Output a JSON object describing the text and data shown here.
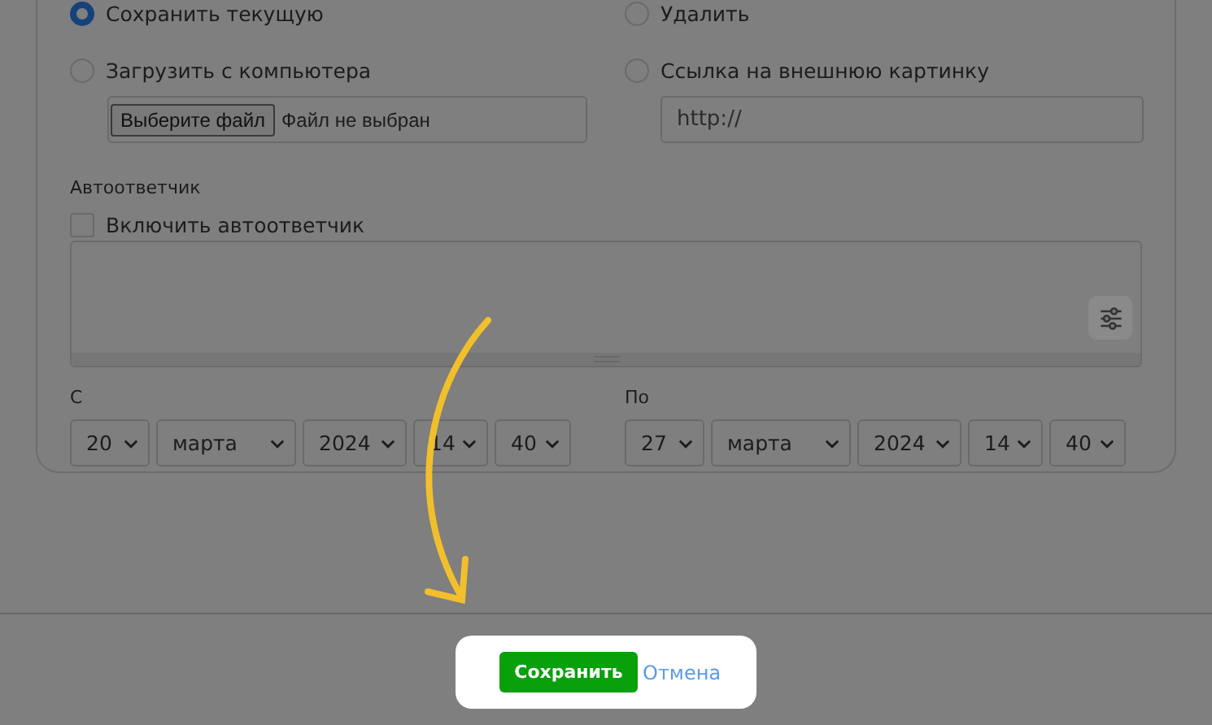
{
  "options": [
    {
      "label": "Сохранить текущую",
      "selected": true
    },
    {
      "label": "Удалить",
      "selected": false
    },
    {
      "label": "Загрузить с компьютера",
      "selected": false
    },
    {
      "label": "Ссылка на внешнюю картинку",
      "selected": false
    }
  ],
  "file_input": {
    "button": "Выберите файл",
    "status": "Файл не выбран"
  },
  "url_field": {
    "value": "http://"
  },
  "autoresponder": {
    "title": "Автоответчик",
    "checkbox": {
      "label": "Включить автоответчик",
      "checked": false
    }
  },
  "from": {
    "label": "С",
    "selects": [
      "20",
      "марта",
      "2024",
      "14",
      "40"
    ]
  },
  "to": {
    "label": "По",
    "selects": [
      "27",
      "марта",
      "2024",
      "14",
      "40"
    ]
  },
  "footer": {
    "save": "Сохранить",
    "cancel": "Отмена"
  }
}
